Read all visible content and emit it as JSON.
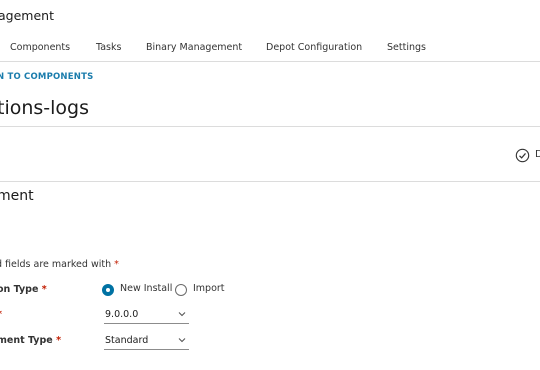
{
  "app": {
    "title": "agement"
  },
  "tabs": [
    {
      "label": "Components"
    },
    {
      "label": "Tasks"
    },
    {
      "label": "Binary Management"
    },
    {
      "label": "Depot Configuration"
    },
    {
      "label": "Settings"
    }
  ],
  "back_link": "N TO COMPONENTS",
  "page_title": "tions-logs",
  "action": {
    "label": "D",
    "icon": "check-circle-icon"
  },
  "section": {
    "title": "ment",
    "required_note": "d fields are marked with",
    "required_marker": "*"
  },
  "form": {
    "installation_type": {
      "label": "on Type",
      "options": [
        {
          "label": "New Install",
          "checked": true
        },
        {
          "label": "Import",
          "checked": false
        }
      ]
    },
    "version": {
      "label": "",
      "value": "9.0.0.0"
    },
    "deployment_type": {
      "label": "ment Type",
      "value": "Standard"
    }
  },
  "colors": {
    "accent": "#0072a3",
    "link": "#1a7cac",
    "required": "#c21d00"
  }
}
